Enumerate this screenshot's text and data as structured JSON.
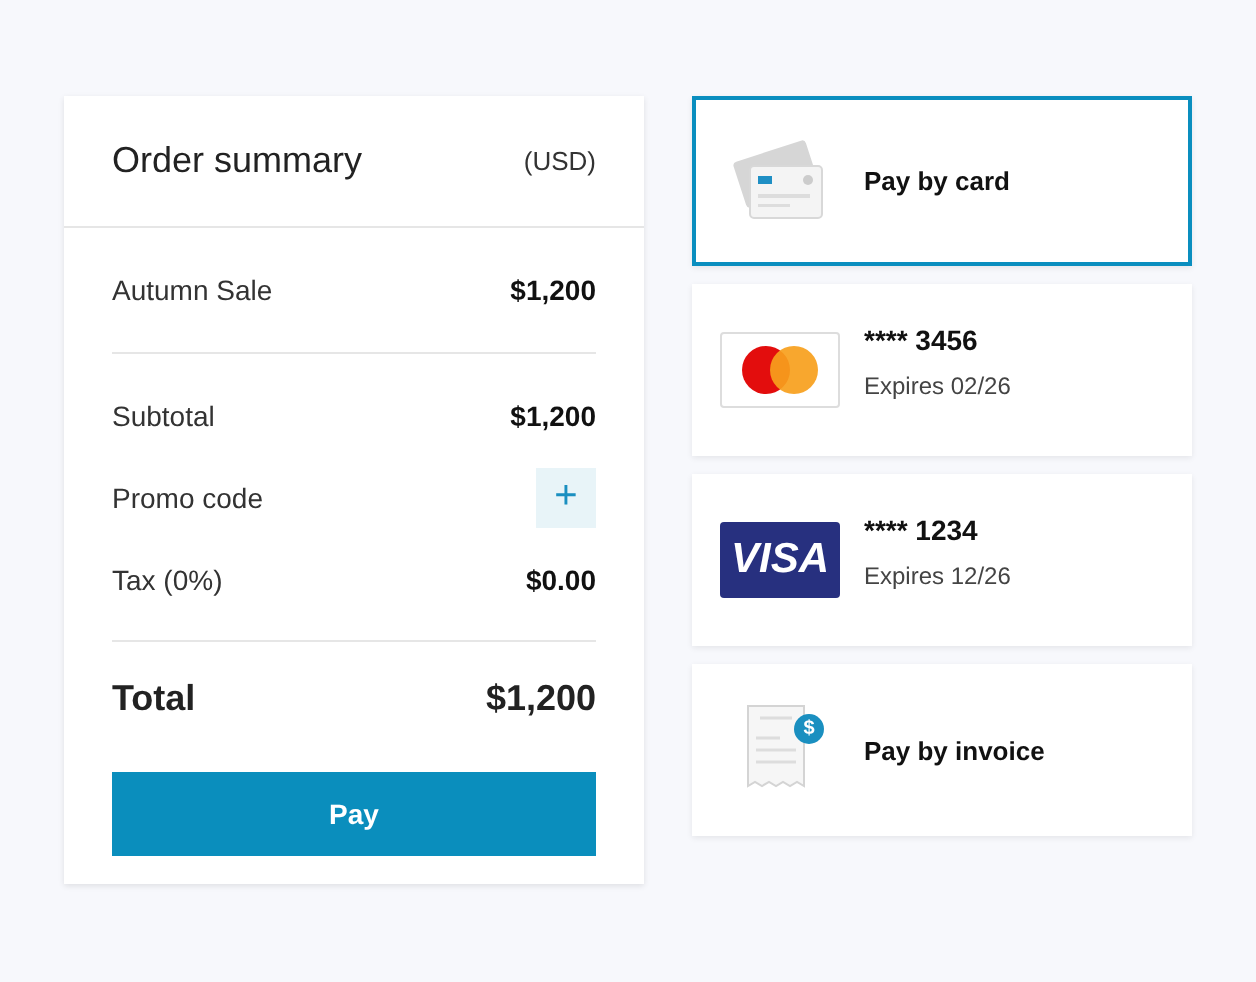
{
  "summary": {
    "title": "Order summary",
    "currency": "(USD)",
    "items": [
      {
        "label": "Autumn Sale",
        "value": "$1,200"
      }
    ],
    "adjustments": [
      {
        "kind": "amount",
        "label": "Subtotal",
        "value": "$1,200"
      },
      {
        "kind": "action",
        "label": "Promo code",
        "action": "+"
      },
      {
        "kind": "amount",
        "label": "Tax (0%)",
        "value": "$0.00"
      }
    ],
    "total": {
      "label": "Total",
      "value": "$1,200"
    },
    "button": "Pay"
  },
  "methods": [
    {
      "kind": "card",
      "label": "Pay by card",
      "selected": true
    },
    {
      "kind": "mastercard",
      "number": "**** 3456",
      "expires": "Expires 02/26",
      "selected": false
    },
    {
      "kind": "visa",
      "logo": "VISA",
      "number": "**** 1234",
      "expires": "Expires 12/26",
      "selected": false
    },
    {
      "kind": "invoice",
      "label": "Pay by invoice",
      "badge": "$",
      "selected": false
    }
  ]
}
